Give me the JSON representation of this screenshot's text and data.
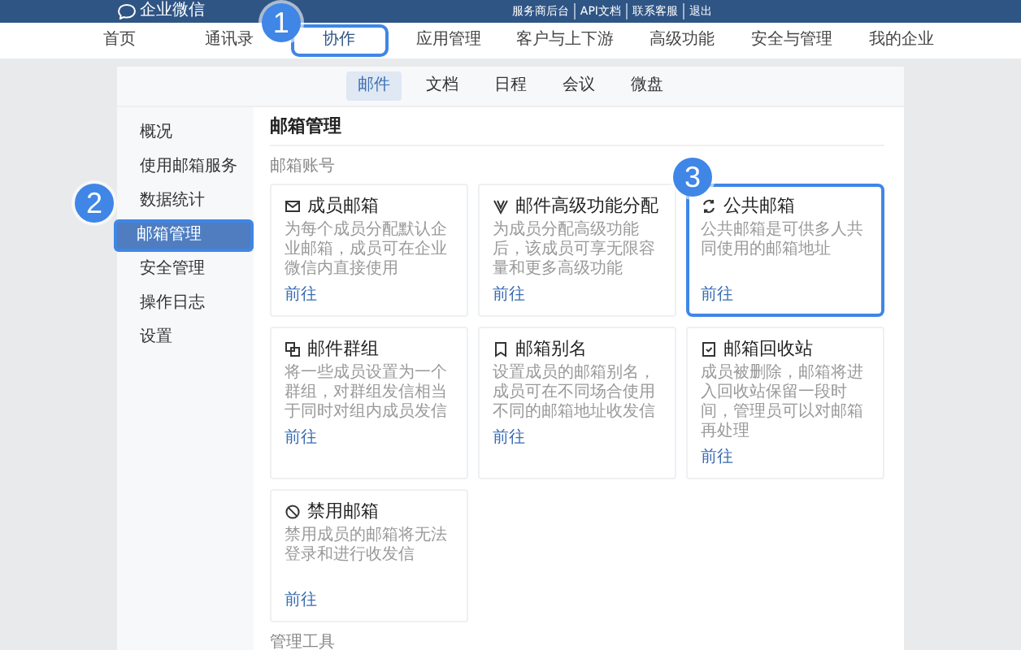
{
  "header": {
    "logo": "企业微信",
    "links": [
      "服务商后台",
      "API文档",
      "联系客服",
      "退出"
    ]
  },
  "nav": [
    {
      "label": "首页",
      "selected": false
    },
    {
      "label": "通讯录",
      "selected": false
    },
    {
      "label": "协作",
      "selected": true,
      "callout": "1"
    },
    {
      "label": "应用管理",
      "selected": false
    },
    {
      "label": "客户与上下游",
      "selected": false
    },
    {
      "label": "高级功能",
      "selected": false
    },
    {
      "label": "安全与管理",
      "selected": false
    },
    {
      "label": "我的企业",
      "selected": false
    }
  ],
  "subtabs": [
    {
      "label": "邮件",
      "selected": true
    },
    {
      "label": "文档",
      "selected": false
    },
    {
      "label": "日程",
      "selected": false
    },
    {
      "label": "会议",
      "selected": false
    },
    {
      "label": "微盘",
      "selected": false
    }
  ],
  "sidebar": {
    "items": [
      {
        "label": "概况",
        "selected": false
      },
      {
        "label": "使用邮箱服务",
        "selected": false
      },
      {
        "label": "数据统计",
        "selected": false
      },
      {
        "label": "邮箱管理",
        "selected": true,
        "callout": "2"
      },
      {
        "label": "安全管理",
        "selected": false
      },
      {
        "label": "操作日志",
        "selected": false
      },
      {
        "label": "设置",
        "selected": false
      }
    ]
  },
  "main": {
    "title": "邮箱管理",
    "sections": [
      {
        "label": "邮箱账号",
        "cards": [
          {
            "kind": "mail",
            "title": "成员邮箱",
            "description": "为每个成员分配默认企业邮箱，成员可在企业微信内直接使用",
            "link": "前往"
          },
          {
            "kind": "v",
            "title": "邮件高级功能分配",
            "description": "为成员分配高级功能后，该成员可享无限容量和更多高级功能",
            "link": "前往"
          },
          {
            "kind": "cycle",
            "title": "公共邮箱",
            "description": "公共邮箱是可供多人共同使用的邮箱地址",
            "link": "前往",
            "callout": "3"
          },
          {
            "kind": "group",
            "title": "邮件群组",
            "description": "将一些成员设置为一个群组，对群组发信相当于同时对组内成员发信",
            "link": "前往"
          },
          {
            "kind": "alias",
            "title": "邮箱别名",
            "description": "设置成员的邮箱别名，成员可在不同场合使用不同的邮箱地址收发信",
            "link": "前往"
          },
          {
            "kind": "bin",
            "title": "邮箱回收站",
            "description": "成员被删除，邮箱将进入回收站保留一段时间，管理员可以对邮箱再处理",
            "link": "前往"
          },
          {
            "kind": "ban",
            "title": "禁用邮箱",
            "description": "禁用成员的邮箱将无法登录和进行收发信",
            "link": "前往"
          }
        ]
      },
      {
        "label": "管理工具"
      }
    ]
  }
}
